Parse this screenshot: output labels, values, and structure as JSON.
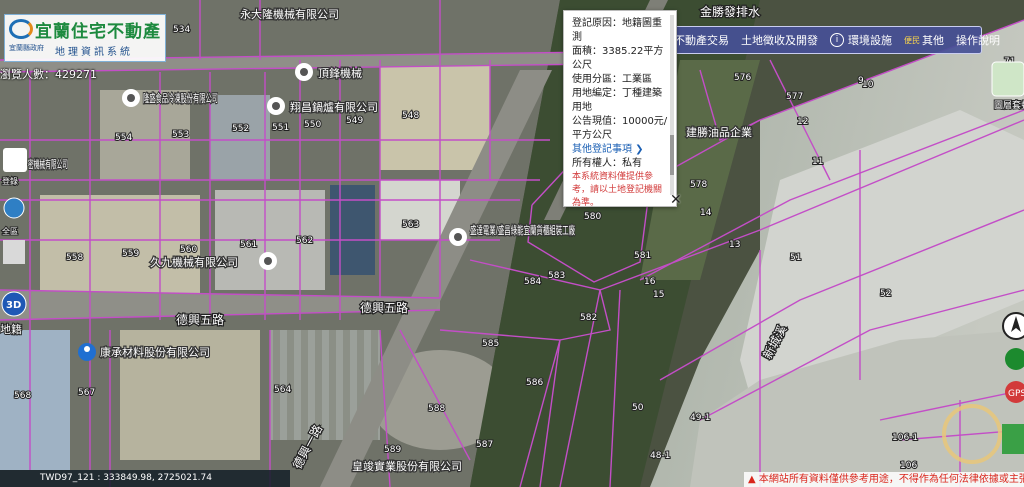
{
  "site": {
    "title": "宜蘭住宅不動產",
    "county": "宜蘭縣政府",
    "subtitle": "地理資訊系統",
    "visitors": "瀏覽人數：429271"
  },
  "toolbar": {
    "items": [
      {
        "label": "不動產交易",
        "icon": "grid-icon"
      },
      {
        "label": "土地徵收及開發",
        "icon": ""
      },
      {
        "label": "環境設施",
        "icon": "info-icon"
      },
      {
        "label": "其他",
        "prefix": "便民",
        "icon": ""
      },
      {
        "label": "操作說明",
        "icon": ""
      }
    ]
  },
  "popup": {
    "reason": "登記原因：地籍圖重測",
    "area": "面積：3385.22平方公尺",
    "zone": "使用分區：工業區",
    "land_use": "用地編定：丁種建築用地",
    "value": "公告現值：10000元/平方公尺",
    "more_link": "其他登記事項 ❯",
    "owner": "所有權人：私有",
    "warning": "本系統資料僅提供參考，請以土地登記機關為準。"
  },
  "map": {
    "pois": [
      {
        "label": "隆盛食品冷凍股份有限公司"
      },
      {
        "label": "翔昌鍋爐有限公司"
      },
      {
        "label": "頂鋒機械"
      },
      {
        "label": "盛達電業/盛昌綠能宜蘭貨櫃組裝工廠"
      },
      {
        "label": "久九機械有限公司"
      },
      {
        "label": "康承材料股份有限公司"
      },
      {
        "label": "建勝油品企業"
      },
      {
        "label": "皇竣實業股份有限公司"
      },
      {
        "label": "密機械有限公司"
      },
      {
        "label": "永大隆機械有限公司"
      }
    ],
    "roads": [
      "德興五路",
      "德興五路",
      "德興一路",
      "新城溪",
      "金勝發排水"
    ],
    "parcels": [
      "534",
      "554",
      "553",
      "552",
      "551",
      "550",
      "549",
      "548",
      "560",
      "561",
      "562",
      "563",
      "559",
      "558",
      "580",
      "581",
      "583",
      "584",
      "582",
      "585",
      "586",
      "587",
      "588",
      "589",
      "564",
      "567",
      "568",
      "576",
      "577",
      "578",
      "10",
      "12",
      "11",
      "13",
      "14",
      "16",
      "15",
      "51",
      "52",
      "50",
      "49-1",
      "48-1",
      "106-1",
      "106",
      "9",
      "71"
    ],
    "left_tools": [
      "登錄",
      "全區",
      "3D",
      "地籍"
    ],
    "right_tools": [
      "圖層套疊",
      "GPS"
    ]
  },
  "status": {
    "coordinates": "TWD97_121 : 333849.98, 2725021.74",
    "disclaimer": "本網站所有資料僅供參考用途，不得作為任何法律依據或主張"
  },
  "colors": {
    "parcel_line": "#c34ec7",
    "highlight": "#d9a83c",
    "toolbar": "#4650a0"
  }
}
